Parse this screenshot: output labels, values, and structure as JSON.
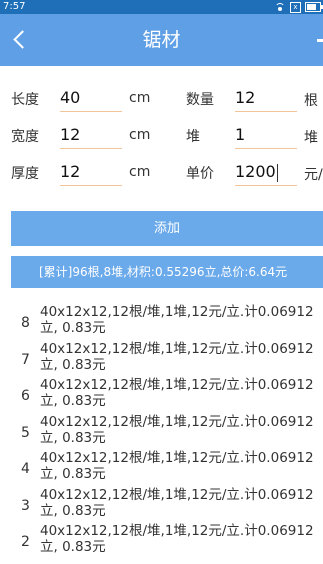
{
  "status_bar": {
    "time": "7:57",
    "sim": "x"
  },
  "header": {
    "title": "锯材"
  },
  "form": {
    "length": {
      "label": "长度",
      "value": "40",
      "unit": "cm"
    },
    "width": {
      "label": "宽度",
      "value": "12",
      "unit": "cm"
    },
    "thickness": {
      "label": "厚度",
      "value": "12",
      "unit": "cm"
    },
    "quantity": {
      "label": "数量",
      "value": "12",
      "unit": "根"
    },
    "stacks": {
      "label": "堆",
      "value": "1",
      "unit": "堆"
    },
    "price": {
      "label": "单价",
      "value": "1200",
      "unit": "元/"
    }
  },
  "add_button": {
    "label": "添加"
  },
  "summary": {
    "text": "[累计]96根,8堆,材积:0.55296立,总价:6.64元"
  },
  "records": [
    {
      "index": "8",
      "text": "40x12x12,12根/堆,1堆,12元/立.计0.06912立, 0.83元"
    },
    {
      "index": "7",
      "text": "40x12x12,12根/堆,1堆,12元/立.计0.06912立, 0.83元"
    },
    {
      "index": "6",
      "text": "40x12x12,12根/堆,1堆,12元/立.计0.06912立, 0.83元"
    },
    {
      "index": "5",
      "text": "40x12x12,12根/堆,1堆,12元/立.计0.06912立, 0.83元"
    },
    {
      "index": "4",
      "text": "40x12x12,12根/堆,1堆,12元/立.计0.06912立, 0.83元"
    },
    {
      "index": "3",
      "text": "40x12x12,12根/堆,1堆,12元/立.计0.06912立, 0.83元"
    },
    {
      "index": "2",
      "text": "40x12x12,12根/堆,1堆,12元/立.计0.06912立, 0.83元"
    }
  ],
  "colors": {
    "status_bar": "#1f6fb8",
    "app_bar": "#5f9fe6",
    "button": "#6aa9ea",
    "underline": "#f2c49a"
  }
}
